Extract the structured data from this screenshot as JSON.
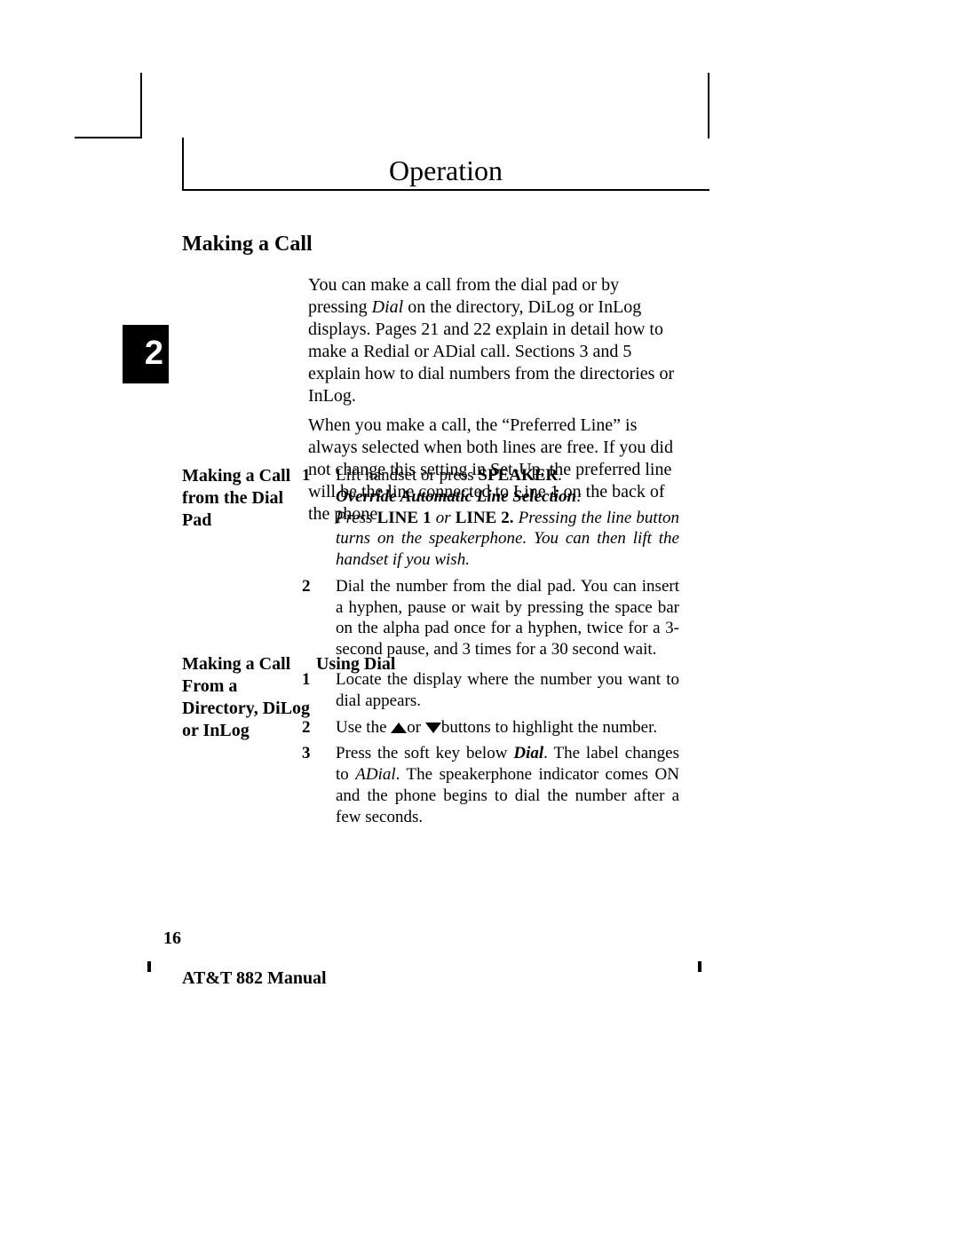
{
  "chapter_number": "2",
  "chapter_title": "Operation",
  "section_heading": "Making a Call",
  "intro": {
    "p1_a": "You can make a call from the dial pad or by pressing ",
    "p1_dial": "Dial",
    "p1_b": " on the directory, DiLog or InLog displays.  Pages 21 and 22 explain in detail how to make a Redial or ADial call.  Sections 3 and 5 explain how to dial numbers from the directories or  InLog.",
    "p2": "When you make a call, the “Preferred Line” is always selected when both lines are free. If you did not change this setting in Set-Up, the preferred line will be the line connected to Line 1 on the back of the phone."
  },
  "sub1": {
    "heading": "Making a Call from the Dial Pad",
    "steps": {
      "s1": {
        "num": "1",
        "a": "Lift handset or press ",
        "speaker": "SPEAKER",
        "dot": ".",
        "override_label": "Override Automatic Line Selection",
        "colon": ":",
        "press": "Press ",
        "line1": "LINE 1",
        "or": " or ",
        "line2": "LINE 2.",
        "tail": "    Pressing the line button turns on the speakerphone.  You can then lift the handset if you wish."
      },
      "s2": {
        "num": "2",
        "body": "Dial the number from the dial pad.  You can insert a hyphen, pause or wait by pressing the space bar on the alpha pad once for a hyphen, twice for a 3-second pause, and 3 times for a 30 second wait."
      }
    }
  },
  "sub2": {
    "heading": "Making a Call From a Directory, DiLog or InLog",
    "subtitle": "Using Dial",
    "steps": {
      "s1": {
        "num": "1",
        "body": "Locate the display where the number you want to dial appears."
      },
      "s2": {
        "num": "2",
        "a": "Use the    ",
        "or": "or   ",
        "b": "buttons to highlight the number."
      },
      "s3": {
        "num": "3",
        "a": "Press the soft key below ",
        "dial": "Dial",
        "b": ".  The label changes to ",
        "adial": "ADial",
        "c": ". The speakerphone indicator comes ON and the phone begins to dial the number after a few seconds."
      }
    }
  },
  "page_number": "16",
  "footer": "AT&T 882 Manual"
}
